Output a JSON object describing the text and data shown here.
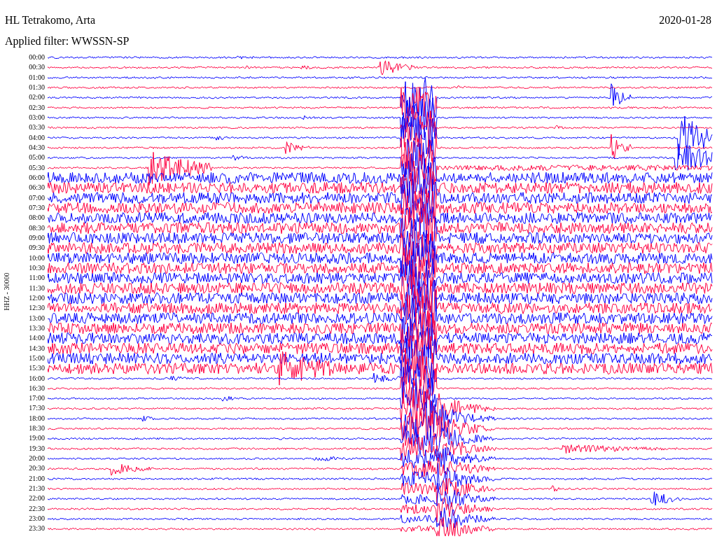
{
  "header": {
    "station": "HL Tetrakomo, Arta",
    "date": "2020-01-28",
    "filter": "Applied filter: WWSSN-SP"
  },
  "channel_label": "HHZ - 30000",
  "traces": [
    {
      "time": "00:00",
      "color": "#0000ff"
    },
    {
      "time": "00:30",
      "color": "#ff0040"
    },
    {
      "time": "01:00",
      "color": "#0000ff"
    },
    {
      "time": "01:30",
      "color": "#ff0040"
    },
    {
      "time": "02:00",
      "color": "#0000ff"
    },
    {
      "time": "02:30",
      "color": "#ff0040"
    },
    {
      "time": "03:00",
      "color": "#0000ff"
    },
    {
      "time": "03:30",
      "color": "#ff0040"
    },
    {
      "time": "04:00",
      "color": "#0000ff"
    },
    {
      "time": "04:30",
      "color": "#ff0040"
    },
    {
      "time": "05:00",
      "color": "#0000ff"
    },
    {
      "time": "05:30",
      "color": "#ff0040"
    },
    {
      "time": "06:00",
      "color": "#0000ff"
    },
    {
      "time": "06:30",
      "color": "#ff0040"
    },
    {
      "time": "07:00",
      "color": "#0000ff"
    },
    {
      "time": "07:30",
      "color": "#ff0040"
    },
    {
      "time": "08:00",
      "color": "#0000ff"
    },
    {
      "time": "08:30",
      "color": "#ff0040"
    },
    {
      "time": "09:00",
      "color": "#0000ff"
    },
    {
      "time": "09:30",
      "color": "#ff0040"
    },
    {
      "time": "10:00",
      "color": "#0000ff"
    },
    {
      "time": "10:30",
      "color": "#ff0040"
    },
    {
      "time": "11:00",
      "color": "#0000ff"
    },
    {
      "time": "11:30",
      "color": "#ff0040"
    },
    {
      "time": "12:00",
      "color": "#0000ff"
    },
    {
      "time": "12:30",
      "color": "#ff0040"
    },
    {
      "time": "13:00",
      "color": "#0000ff"
    },
    {
      "time": "13:30",
      "color": "#ff0040"
    },
    {
      "time": "14:00",
      "color": "#0000ff"
    },
    {
      "time": "14:30",
      "color": "#ff0040"
    },
    {
      "time": "15:00",
      "color": "#0000ff"
    },
    {
      "time": "15:30",
      "color": "#ff0040"
    },
    {
      "time": "16:00",
      "color": "#0000ff"
    },
    {
      "time": "16:30",
      "color": "#ff0040"
    },
    {
      "time": "17:00",
      "color": "#0000ff"
    },
    {
      "time": "17:30",
      "color": "#ff0040"
    },
    {
      "time": "18:00",
      "color": "#0000ff"
    },
    {
      "time": "18:30",
      "color": "#ff0040"
    },
    {
      "time": "19:00",
      "color": "#0000ff"
    },
    {
      "time": "19:30",
      "color": "#ff0040"
    },
    {
      "time": "20:00",
      "color": "#0000ff"
    },
    {
      "time": "20:30",
      "color": "#ff0040"
    },
    {
      "time": "21:00",
      "color": "#0000ff"
    },
    {
      "time": "21:30",
      "color": "#ff0040"
    },
    {
      "time": "22:00",
      "color": "#0000ff"
    },
    {
      "time": "22:30",
      "color": "#ff0040"
    },
    {
      "time": "23:00",
      "color": "#0000ff"
    },
    {
      "time": "23:30",
      "color": "#ff0040"
    }
  ]
}
